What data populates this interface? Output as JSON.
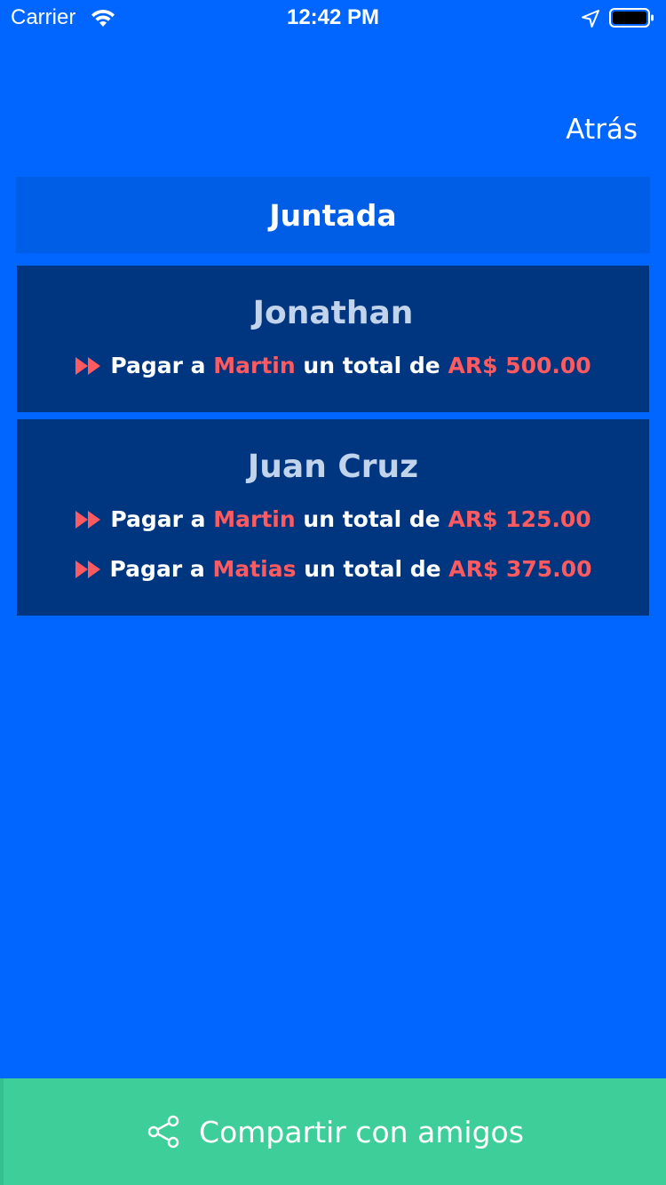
{
  "status_bar": {
    "carrier": "Carrier",
    "time": "12:42 PM"
  },
  "nav": {
    "back_label": "Atrás"
  },
  "group": {
    "title": "Juntada"
  },
  "people": [
    {
      "name": "Jonathan",
      "payments": [
        {
          "prefix": "Pagar a",
          "to": "Martin",
          "middle": "un total de",
          "amount": "AR$ 500.00"
        }
      ]
    },
    {
      "name": "Juan Cruz",
      "payments": [
        {
          "prefix": "Pagar a",
          "to": "Martin",
          "middle": "un total de",
          "amount": "AR$ 125.00"
        },
        {
          "prefix": "Pagar a",
          "to": "Matias",
          "middle": "un total de",
          "amount": "AR$ 375.00"
        }
      ]
    }
  ],
  "share": {
    "label": "Compartir con amigos",
    "icon": "share-icon"
  },
  "colors": {
    "background": "#0066FF",
    "header": "#005EE6",
    "card": "#003680",
    "name": "#C2D3EC",
    "highlight": "#FF5A5F",
    "share_button": "#3DCE99"
  }
}
